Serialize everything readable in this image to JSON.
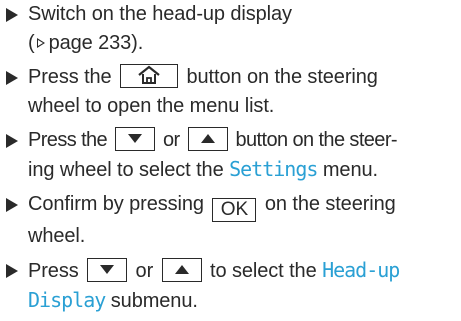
{
  "steps": [
    {
      "line1": "Switch on the head-up display",
      "ref_open": "(",
      "ref_text": "page 233).",
      "ref_icon": "page-reference-arrow-icon"
    },
    {
      "pre": "Press the",
      "key_icon": "home-icon",
      "post": "button on the steering",
      "line2": "wheel to open the menu list."
    },
    {
      "pre": "Press the",
      "mid": "or",
      "post": "button on the steer-",
      "line2_pre": "ing wheel to select the",
      "menu": "Settings",
      "line2_post": "menu.",
      "key_icons": [
        "down-arrow-icon",
        "up-arrow-icon"
      ]
    },
    {
      "pre": "Confirm by pressing",
      "key_label": "OK",
      "post": "on the steering",
      "line2": "wheel."
    },
    {
      "pre": "Press",
      "mid": "or",
      "post": "to select the",
      "menu_part1": "Head-up",
      "menu_part2": "Display",
      "line2_post": "submenu."
    }
  ],
  "colors": {
    "text": "#2a2a2a",
    "menu_highlight": "#2aa0d4"
  }
}
